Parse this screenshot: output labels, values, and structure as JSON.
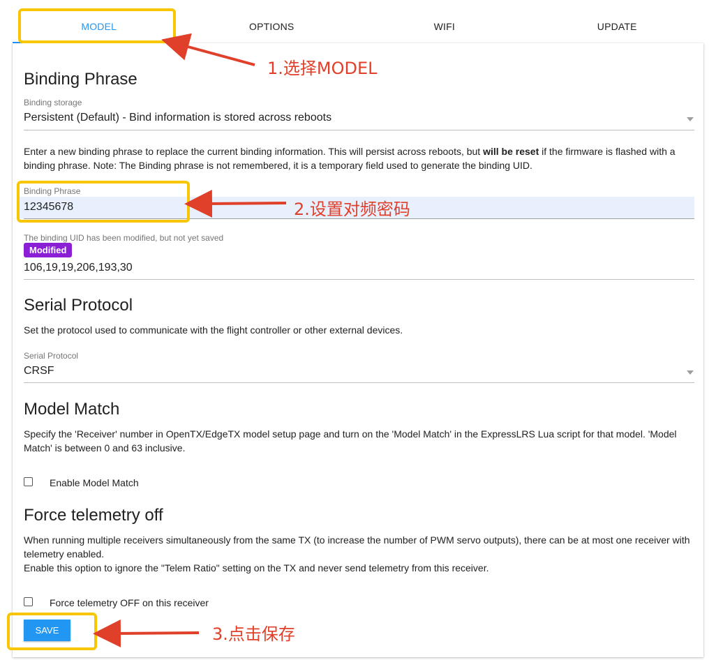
{
  "tabs": [
    {
      "label": "MODEL"
    },
    {
      "label": "OPTIONS"
    },
    {
      "label": "WIFI"
    },
    {
      "label": "UPDATE"
    }
  ],
  "binding": {
    "title": "Binding Phrase",
    "storage_label": "Binding storage",
    "storage_value": "Persistent (Default) - Bind information is stored across reboots",
    "description_pre": "Enter a new binding phrase to replace the current binding information. This will persist across reboots, but ",
    "description_bold": "will be reset",
    "description_post": " if the firmware is flashed with a binding phrase. Note: The Binding phrase is not remembered, it is a temporary field used to generate the binding UID.",
    "phrase_label": "Binding Phrase",
    "phrase_value": "12345678",
    "uid_label": "The binding UID has been modified, but not yet saved",
    "badge": "Modified",
    "uid_value": "106,19,19,206,193,30"
  },
  "serial": {
    "title": "Serial Protocol",
    "description": "Set the protocol used to communicate with the flight controller or other external devices.",
    "field_label": "Serial Protocol",
    "field_value": "CRSF"
  },
  "model_match": {
    "title": "Model Match",
    "description": "Specify the 'Receiver' number in OpenTX/EdgeTX model setup page and turn on the 'Model Match' in the ExpressLRS Lua script for that model. 'Model Match' is between 0 and 63 inclusive.",
    "checkbox_label": "Enable Model Match"
  },
  "telemetry": {
    "title": "Force telemetry off",
    "description_1": "When running multiple receivers simultaneously from the same TX (to increase the number of PWM servo outputs), there can be at most one receiver with telemetry enabled.",
    "description_2": "Enable this option to ignore the \"Telem Ratio\" setting on the TX and never send telemetry from this receiver.",
    "checkbox_label": "Force telemetry OFF on this receiver"
  },
  "save_label": "SAVE",
  "annotations": {
    "step1": "1.选择MODEL",
    "step2": "2.设置对频密码",
    "step3": "3.点击保存"
  },
  "colors": {
    "accent": "#2196f3",
    "badge": "#8a1fd6",
    "highlight": "#f7c600",
    "annotation": "#e0402a",
    "input_fill": "#e8f0fe"
  }
}
